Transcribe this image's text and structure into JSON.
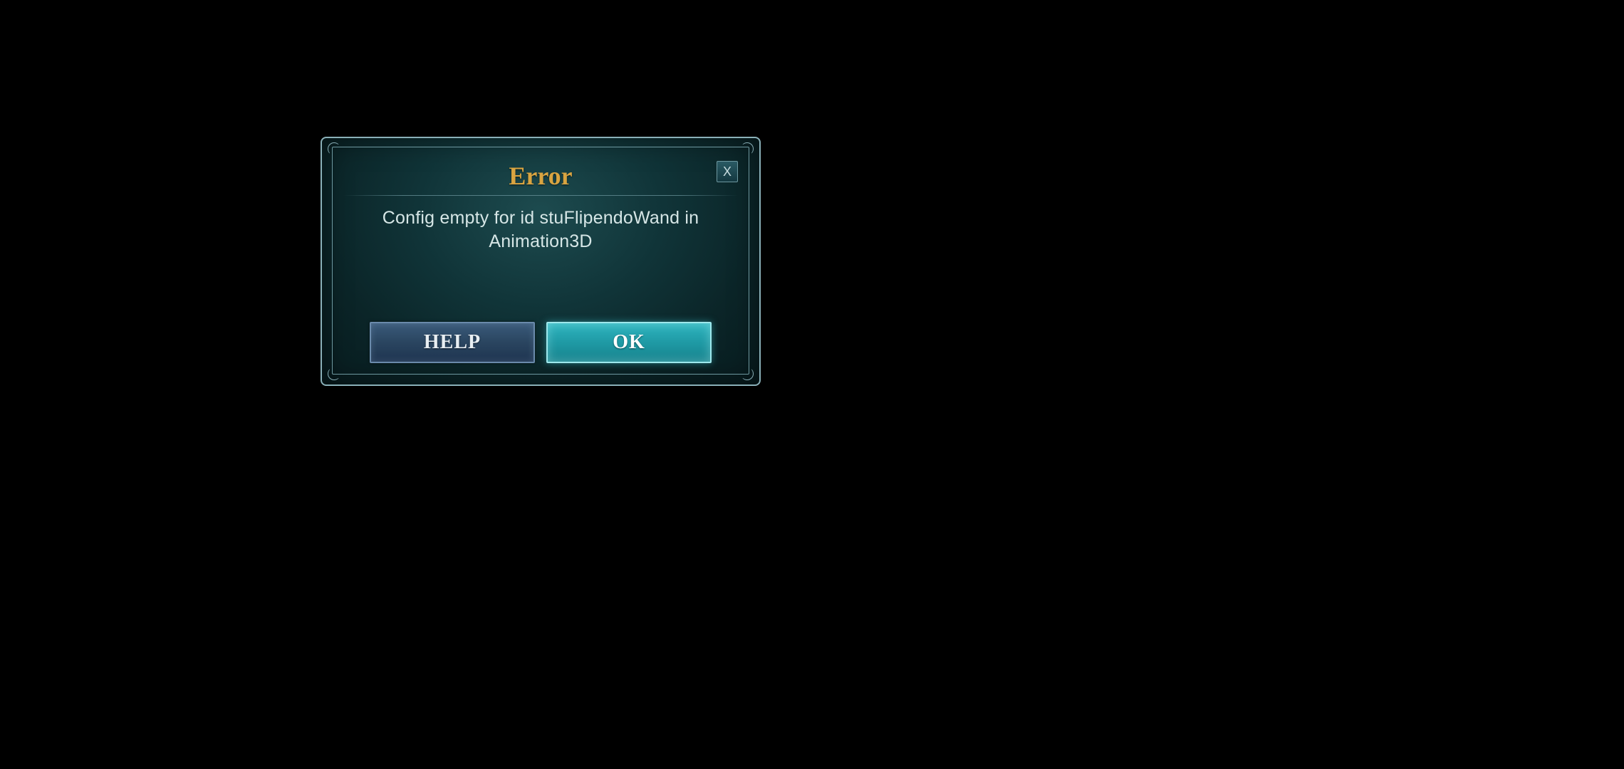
{
  "dialog": {
    "title": "Error",
    "message": "Config empty for id stuFlipendoWand in Animation3D",
    "close_label": "X",
    "buttons": {
      "help": "HELP",
      "ok": "OK"
    }
  }
}
